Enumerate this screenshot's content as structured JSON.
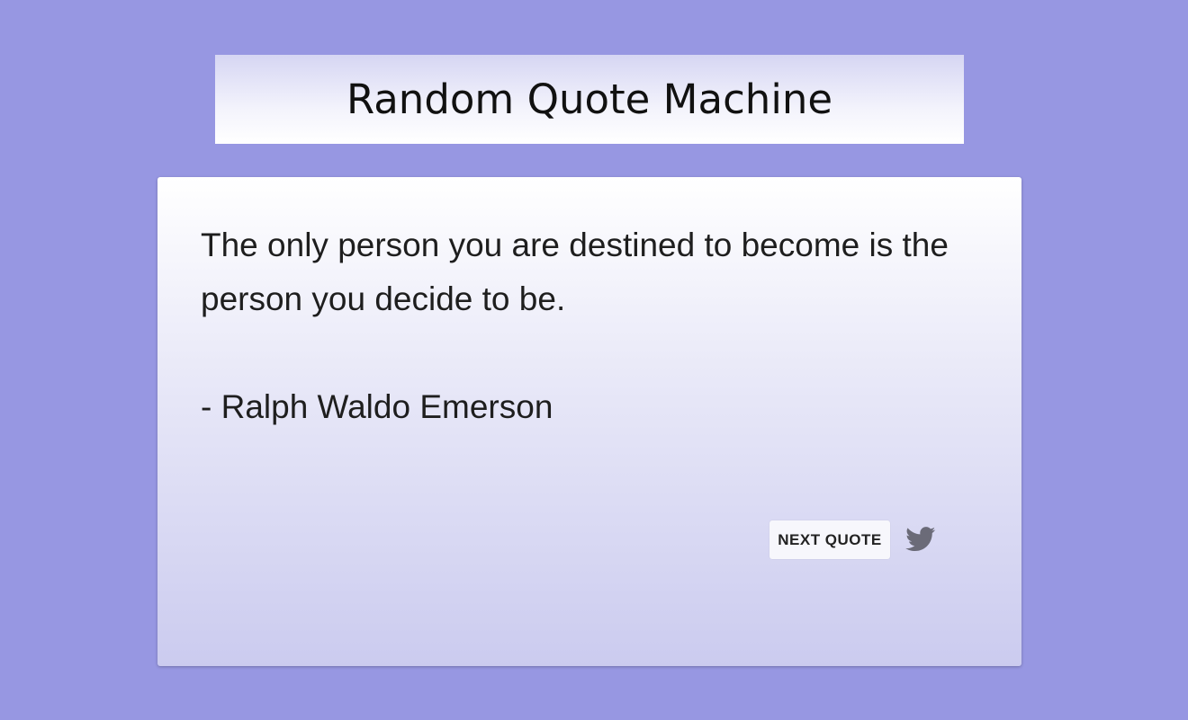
{
  "header": {
    "title": "Random Quote Machine"
  },
  "quote": {
    "text": "The only person you are destined to become is the person you decide to be.",
    "author": "- Ralph Waldo Emerson"
  },
  "actions": {
    "next_label": "NEXT QUOTE",
    "tweet_icon": "twitter-icon"
  },
  "colors": {
    "background": "#9797e2",
    "icon": "#6b6b78"
  }
}
